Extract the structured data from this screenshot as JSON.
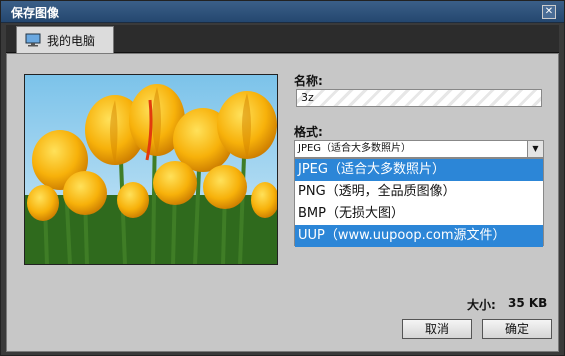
{
  "window": {
    "title": "保存图像",
    "close_label": "✕"
  },
  "tab": {
    "label": "我的电脑"
  },
  "form": {
    "name_label": "名称:",
    "name_value": "3z",
    "format_label": "格式:",
    "format_selected": "JPEG（适合大多数照片）",
    "options": [
      "JPEG（适合大多数照片）",
      "PNG（透明，全品质图像）",
      "BMP（无损大图）",
      "UUP（www.uupoop.com源文件）"
    ]
  },
  "size": {
    "label": "大小:",
    "value": "35 KB"
  },
  "buttons": {
    "cancel": "取消",
    "ok": "确定"
  },
  "colors": {
    "selection": "#2c86d7",
    "titlebar": "#2a4d78",
    "panel": "#c7c7c7"
  }
}
